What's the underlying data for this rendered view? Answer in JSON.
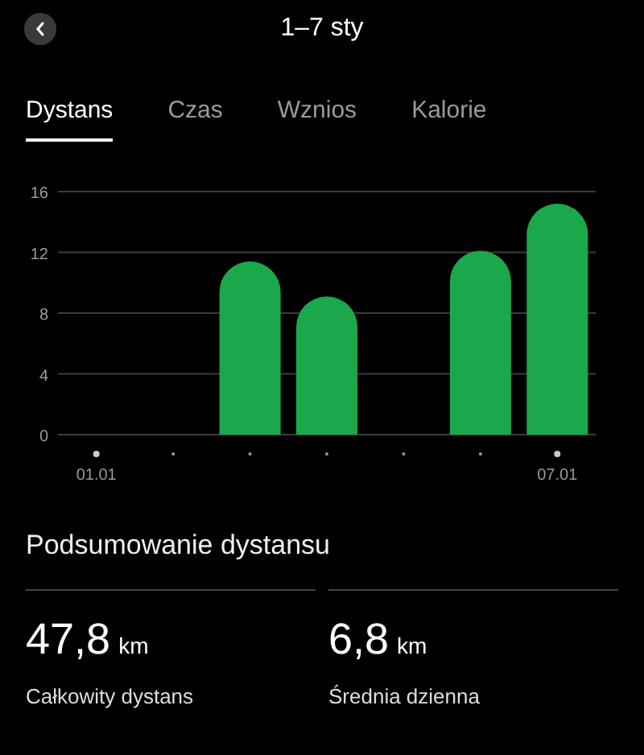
{
  "header": {
    "title": "1–7 sty"
  },
  "tabs": [
    {
      "label": "Dystans",
      "selected": true
    },
    {
      "label": "Czas",
      "selected": false
    },
    {
      "label": "Wznios",
      "selected": false
    },
    {
      "label": "Kalorie",
      "selected": false
    }
  ],
  "chart_data": {
    "type": "bar",
    "categories": [
      "01.01",
      null,
      null,
      null,
      null,
      null,
      "07.01"
    ],
    "series": [
      {
        "color": "#1aa84a",
        "values": [
          0,
          0,
          11.4,
          9.1,
          0,
          12.1,
          15.2
        ]
      }
    ],
    "ylim": [
      0,
      16
    ],
    "yticks": [
      0,
      4,
      8,
      12,
      16
    ],
    "grid": true
  },
  "summary": {
    "title": "Podsumowanie dystansu",
    "stats": [
      {
        "value": "47,8",
        "unit": "km",
        "label": "Całkowity dystans"
      },
      {
        "value": "6,8",
        "unit": "km",
        "label": "Średnia dzienna"
      }
    ]
  }
}
